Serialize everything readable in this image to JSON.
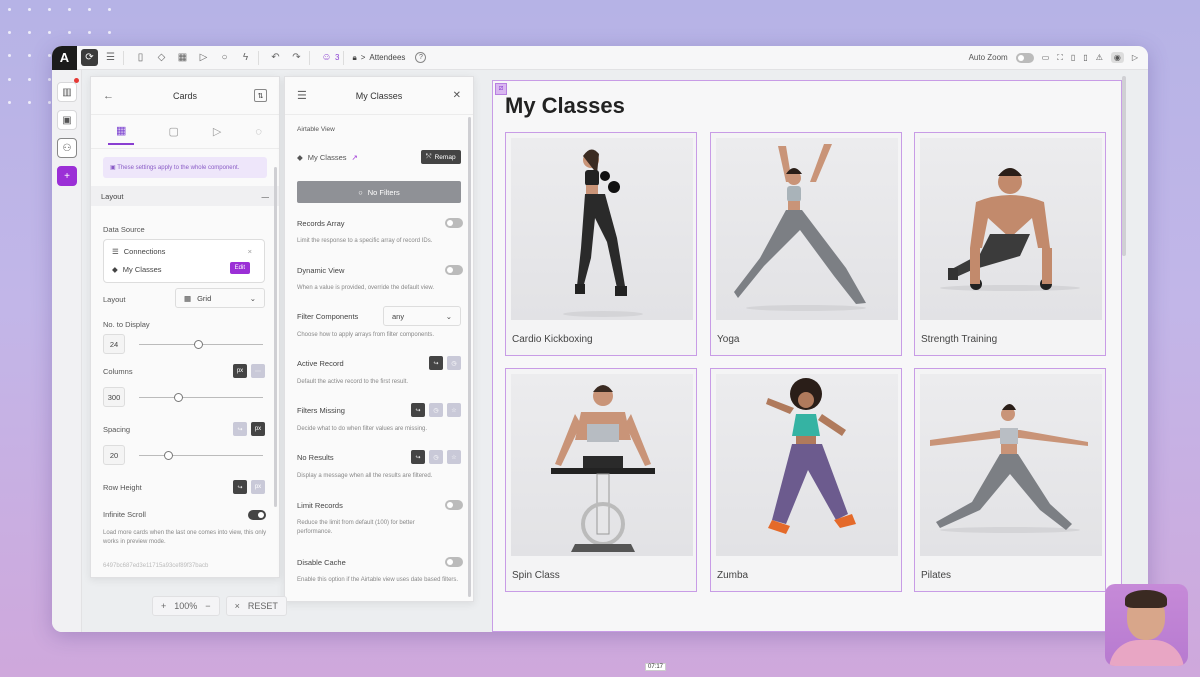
{
  "topbar": {
    "logo": "A",
    "user_count": "3",
    "breadcrumb_arrow": ">",
    "breadcrumb_page": "Attendees",
    "help_glyph": "?",
    "auto_zoom_label": "Auto Zoom"
  },
  "cards_panel": {
    "title": "Cards",
    "info": "These settings apply to the whole component.",
    "layout_section": "Layout",
    "collapse": "—",
    "data_source_label": "Data Source",
    "connections_label": "Connections",
    "connection_name": "My Classes",
    "edit_label": "Edit",
    "layout_label": "Layout",
    "layout_value": "Grid",
    "no_to_display_label": "No. to Display",
    "no_to_display_value": "24",
    "no_to_display_pos": 0.48,
    "columns_label": "Columns",
    "columns_value": "300",
    "columns_pos": 0.3,
    "spacing_label": "Spacing",
    "spacing_value": "20",
    "spacing_pos": 0.22,
    "row_height_label": "Row Height",
    "infinite_scroll_label": "Infinite Scroll",
    "infinite_scroll_desc": "Load more cards when the last one comes into view, this only works in preview mode.",
    "component_id": "6497bc687ed3e11715a93cef89f37bacb",
    "px_label": "px"
  },
  "classes_panel": {
    "title": "My Classes",
    "airtable_view_label": "Airtable View",
    "view_name": "My Classes",
    "remap_label": "Remap",
    "no_filters_label": "No Filters",
    "records_array_label": "Records Array",
    "records_array_desc": "Limit the response to a specific array of record IDs.",
    "dynamic_view_label": "Dynamic View",
    "dynamic_view_desc": "When a value is provided, override the default view.",
    "filter_components_label": "Filter Components",
    "filter_components_value": "any",
    "filter_components_desc": "Choose how to apply arrays from filter components.",
    "active_record_label": "Active Record",
    "active_record_desc": "Default the active record to the first result.",
    "filters_missing_label": "Filters Missing",
    "filters_missing_desc": "Decide what to do when filter values are missing.",
    "no_results_label": "No Results",
    "no_results_desc": "Display a message when all the results are filtered.",
    "limit_records_label": "Limit Records",
    "limit_records_desc": "Reduce the limit from default (100) for better performance.",
    "disable_cache_label": "Disable Cache",
    "disable_cache_desc": "Enable this option if the Airtable view uses date based filters."
  },
  "zoom": {
    "plus": "+",
    "value": "100%",
    "minus": "−",
    "reset_label": "RESET",
    "reset_icon": "×"
  },
  "canvas": {
    "title": "My Classes",
    "cards": [
      {
        "caption": "Cardio Kickboxing"
      },
      {
        "caption": "Yoga"
      },
      {
        "caption": "Strength Training"
      },
      {
        "caption": "Spin Class"
      },
      {
        "caption": "Zumba"
      },
      {
        "caption": "Pilates"
      }
    ]
  },
  "video_time": "07:17",
  "colors": {
    "accent": "#9b2fd6",
    "card_border": "#c89ce6"
  }
}
